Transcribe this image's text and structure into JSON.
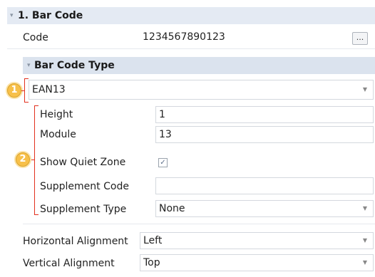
{
  "section": {
    "title": "1. Bar Code"
  },
  "code": {
    "label": "Code",
    "value": "1234567890123",
    "browse_label": "..."
  },
  "barcode_type": {
    "title": "Bar Code Type",
    "selected": "EAN13",
    "callout": "1"
  },
  "properties": {
    "callout": "2",
    "height": {
      "label": "Height",
      "value": "1"
    },
    "module": {
      "label": "Module",
      "value": "13"
    },
    "quiet_zone": {
      "label": "Show Quiet Zone",
      "checked": true,
      "check_glyph": "✓"
    },
    "supplement_code": {
      "label": "Supplement Code",
      "value": ""
    },
    "supplement_type": {
      "label": "Supplement Type",
      "value": "None"
    }
  },
  "alignment": {
    "horizontal": {
      "label": "Horizontal Alignment",
      "value": "Left"
    },
    "vertical": {
      "label": "Vertical Alignment",
      "value": "Top"
    }
  },
  "icons": {
    "collapse": "▾",
    "dropdown": "▼"
  }
}
